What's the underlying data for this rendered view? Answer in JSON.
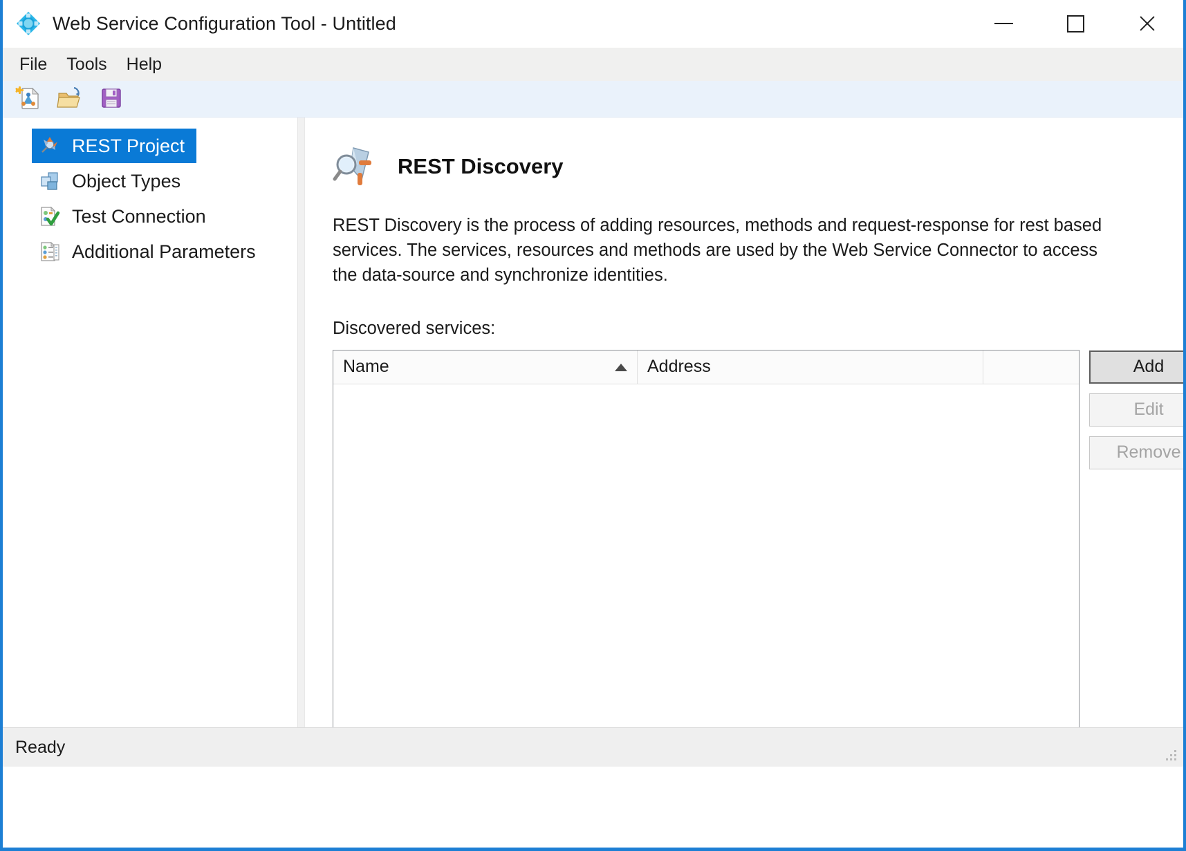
{
  "window": {
    "title": "Web Service Configuration Tool - Untitled",
    "logo_icon": "blue-diamond-logo-icon",
    "controls": [
      {
        "name": "minimize-button",
        "icon": "minimize-icon"
      },
      {
        "name": "maximize-button",
        "icon": "maximize-icon"
      },
      {
        "name": "close-button",
        "icon": "close-icon"
      }
    ]
  },
  "menubar": {
    "items": [
      {
        "label": "File"
      },
      {
        "label": "Tools"
      },
      {
        "label": "Help"
      }
    ]
  },
  "toolbar": {
    "buttons": [
      {
        "name": "new-project-button",
        "icon": "new-document-icon"
      },
      {
        "name": "open-project-button",
        "icon": "open-folder-icon"
      },
      {
        "name": "save-project-button",
        "icon": "save-diskette-icon"
      }
    ]
  },
  "sidebar": {
    "items": [
      {
        "label": "REST Project",
        "icon": "rest-project-icon",
        "selected": true
      },
      {
        "label": "Object Types",
        "icon": "object-types-icon",
        "selected": false
      },
      {
        "label": "Test Connection",
        "icon": "test-connection-icon",
        "selected": false
      },
      {
        "label": "Additional Parameters",
        "icon": "additional-parameters-icon",
        "selected": false
      }
    ]
  },
  "main": {
    "heading": "REST Discovery",
    "heading_icon": "rest-discovery-magnifier-icon",
    "description": "REST Discovery is the process of adding resources, methods and request-response for rest based services. The services, resources and methods are used by the Web Service Connector to access the data-source and synchronize identities.",
    "list_label": "Discovered services:",
    "listview": {
      "columns": [
        {
          "label": "Name",
          "sorted": "ascending"
        },
        {
          "label": "Address",
          "sorted": ""
        },
        {
          "label": "",
          "sorted": ""
        }
      ],
      "rows": []
    },
    "buttons": [
      {
        "label": "Add",
        "state": "focused"
      },
      {
        "label": "Edit",
        "state": "disabled"
      },
      {
        "label": "Remove",
        "state": "disabled"
      }
    ]
  },
  "statusbar": {
    "text": "Ready",
    "grip_icon": "resize-grip-icon"
  },
  "colors": {
    "selection_blue": "#0a7ad6",
    "window_border": "#1d7fd4",
    "toolbar_band": "#eaf2fb",
    "menubar": "#f0f0ef",
    "statusbar": "#efefef"
  }
}
